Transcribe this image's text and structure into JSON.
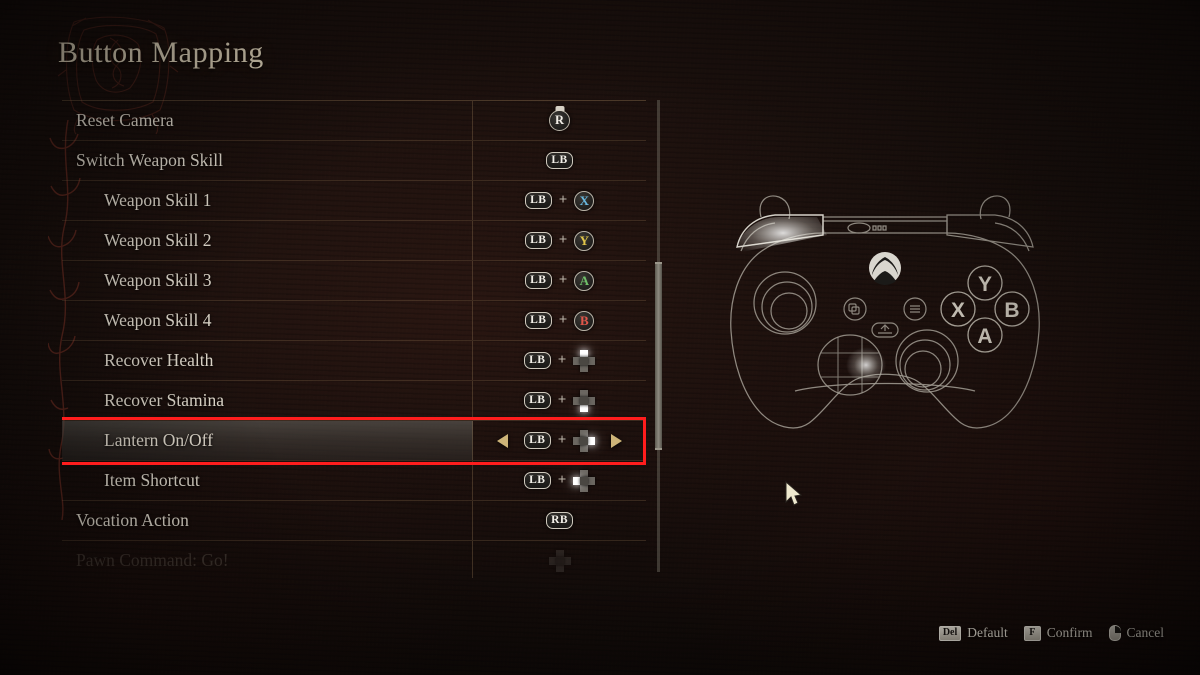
{
  "page": {
    "title": "Button Mapping",
    "accent_red": "#ff1d1d",
    "title_color": "#e8dcc2"
  },
  "list": {
    "rows": [
      {
        "label": "Reset Camera",
        "indent": false,
        "faded": false,
        "selected": false,
        "glyphs": [
          {
            "type": "stick",
            "text": "R"
          }
        ]
      },
      {
        "label": "Switch Weapon Skill",
        "indent": false,
        "faded": false,
        "selected": false,
        "glyphs": [
          {
            "type": "pill",
            "text": "LB"
          }
        ]
      },
      {
        "label": "Weapon Skill 1",
        "indent": true,
        "faded": false,
        "selected": false,
        "glyphs": [
          {
            "type": "pill",
            "text": "LB"
          },
          {
            "type": "plus",
            "text": "+"
          },
          {
            "type": "face",
            "text": "X",
            "color": "#69b9e0"
          }
        ]
      },
      {
        "label": "Weapon Skill 2",
        "indent": true,
        "faded": false,
        "selected": false,
        "glyphs": [
          {
            "type": "pill",
            "text": "LB"
          },
          {
            "type": "plus",
            "text": "+"
          },
          {
            "type": "face",
            "text": "Y",
            "color": "#e0c64a"
          }
        ]
      },
      {
        "label": "Weapon Skill 3",
        "indent": true,
        "faded": false,
        "selected": false,
        "glyphs": [
          {
            "type": "pill",
            "text": "LB"
          },
          {
            "type": "plus",
            "text": "+"
          },
          {
            "type": "face",
            "text": "A",
            "color": "#6fc06a"
          }
        ]
      },
      {
        "label": "Weapon Skill 4",
        "indent": true,
        "faded": false,
        "selected": false,
        "glyphs": [
          {
            "type": "pill",
            "text": "LB"
          },
          {
            "type": "plus",
            "text": "+"
          },
          {
            "type": "face",
            "text": "B",
            "color": "#e0564a"
          }
        ]
      },
      {
        "label": "Recover Health",
        "indent": true,
        "faded": false,
        "selected": false,
        "glyphs": [
          {
            "type": "pill",
            "text": "LB"
          },
          {
            "type": "plus",
            "text": "+"
          },
          {
            "type": "dpad",
            "direction": "up"
          }
        ]
      },
      {
        "label": "Recover Stamina",
        "indent": true,
        "faded": false,
        "selected": false,
        "glyphs": [
          {
            "type": "pill",
            "text": "LB"
          },
          {
            "type": "plus",
            "text": "+"
          },
          {
            "type": "dpad",
            "direction": "down"
          }
        ]
      },
      {
        "label": "Lantern On/Off",
        "indent": true,
        "faded": false,
        "selected": true,
        "glyphs": [
          {
            "type": "pill",
            "text": "LB"
          },
          {
            "type": "plus",
            "text": "+"
          },
          {
            "type": "dpad",
            "direction": "right"
          }
        ]
      },
      {
        "label": "Item Shortcut",
        "indent": true,
        "faded": false,
        "selected": false,
        "glyphs": [
          {
            "type": "pill",
            "text": "LB"
          },
          {
            "type": "plus",
            "text": "+"
          },
          {
            "type": "dpad",
            "direction": "left"
          }
        ]
      },
      {
        "label": "Vocation Action",
        "indent": false,
        "faded": false,
        "selected": false,
        "glyphs": [
          {
            "type": "pill",
            "text": "RB"
          }
        ]
      },
      {
        "label": "Pawn Command: Go!",
        "indent": false,
        "faded": true,
        "selected": false,
        "glyphs": [
          {
            "type": "dpad",
            "direction": "none"
          }
        ]
      }
    ]
  },
  "footer": {
    "hints": [
      {
        "key": "Del",
        "key_type": "keycap",
        "label": "Default"
      },
      {
        "key": "F",
        "key_type": "keycap",
        "label": "Confirm"
      },
      {
        "key": "",
        "key_type": "mouse",
        "label": "Cancel"
      }
    ]
  },
  "controller": {
    "type": "xbox",
    "highlighted": [
      "LB",
      "dpad-right"
    ]
  }
}
